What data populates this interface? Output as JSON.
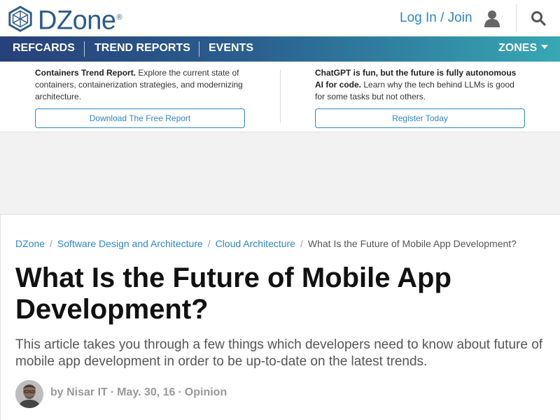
{
  "brand": {
    "name": "DZone",
    "reg_mark": "®"
  },
  "header": {
    "login_label": "Log In / Join"
  },
  "nav": {
    "items": [
      {
        "label": "REFCARDS"
      },
      {
        "label": "TREND REPORTS"
      },
      {
        "label": "EVENTS"
      }
    ],
    "zones_label": "ZONES"
  },
  "promo": [
    {
      "title": "Containers Trend Report.",
      "text": "Explore the current state of containers, containerization strategies, and modernizing architecture.",
      "button": "Download The Free Report"
    },
    {
      "title": "ChatGPT is fun, but the future is fully autonomous AI for code.",
      "text": "Learn why the tech behind LLMs is good for some tasks but not others.",
      "button": "Register Today"
    }
  ],
  "breadcrumb": [
    "DZone",
    "Software Design and Architecture",
    "Cloud Architecture",
    "What Is the Future of Mobile App Development?"
  ],
  "breadcrumb_separator": "/",
  "article": {
    "title": "What Is the Future of Mobile App Development?",
    "subtitle": "This article takes you through a few things which developers need to know about future of mobile app development in order to be up-to-date on the latest trends.",
    "byline": {
      "by_prefix": "by",
      "author": "Nisar IT",
      "date": "May. 30, 16",
      "category": "Opinion",
      "dot": "·"
    }
  },
  "colors": {
    "brand": "#2b5b8a",
    "link": "#2e86c8",
    "nav_start": "#27417a",
    "nav_end": "#37a8b4"
  }
}
